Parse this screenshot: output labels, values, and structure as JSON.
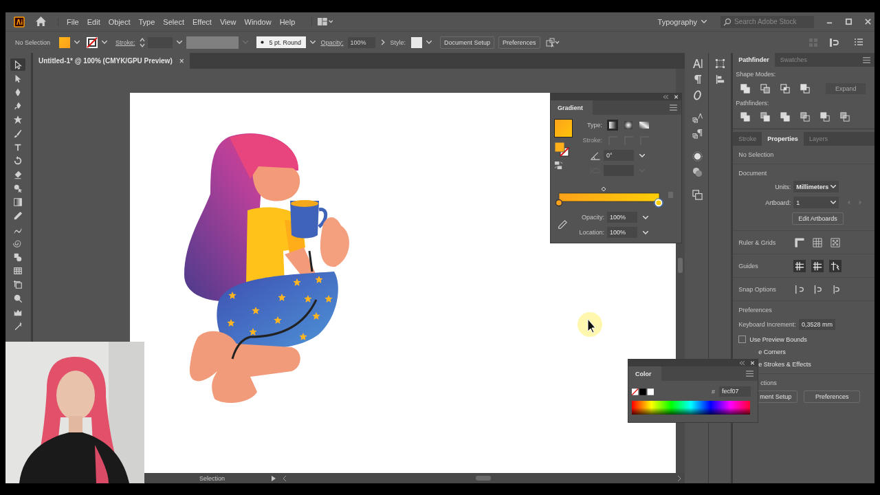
{
  "menu_bar": {
    "items": [
      "File",
      "Edit",
      "Object",
      "Type",
      "Select",
      "Effect",
      "View",
      "Window",
      "Help"
    ],
    "workspace": "Typography",
    "search": {
      "placeholder": "Search Adobe Stock"
    }
  },
  "control_bar": {
    "selection": "No Selection",
    "stroke_label": "Stroke:",
    "brush": "5 pt. Round",
    "opacity_label": "Opacity:",
    "opacity": "100%",
    "style_label": "Style:",
    "buttons": [
      "Document Setup",
      "Preferences"
    ]
  },
  "document_tab": {
    "title": "Untitled-1* @ 100% (CMYK/GPU Preview)",
    "close": "×"
  },
  "gradient_panel": {
    "title": "Gradient",
    "type_label": "Type:",
    "stroke_row": {
      "label": "Stroke:",
      "disabled": true
    },
    "angle": "0°",
    "stops": [
      {
        "selected": false
      },
      {
        "selected": true
      }
    ],
    "opacity_label": "Opacity:",
    "opacity": "100%",
    "location_label": "Location:",
    "location": "100%"
  },
  "right_panel": {
    "top_tabs": [
      {
        "label": "Pathfinder",
        "selected": true
      },
      {
        "label": "Swatches",
        "selected": false
      }
    ],
    "shape_modes": "Shape Modes:",
    "expand": {
      "label": "Expand",
      "disabled": true
    },
    "pathfinders": "Pathfinders:",
    "tabs": [
      {
        "label": "Stroke",
        "selected": false
      },
      {
        "label": "Properties",
        "selected": true
      },
      {
        "label": "Layers",
        "selected": false
      }
    ],
    "selection": "No Selection",
    "document": "Document",
    "units_label": "Units:",
    "units": "Millimeters",
    "artboard_label": "Artboard:",
    "artboard": "1",
    "edit_artboards": "Edit Artboards",
    "rows": [
      "Ruler & Grids",
      "Guides",
      "Snap Options"
    ],
    "preferences": "Preferences",
    "keyboard_label": "Keyboard Increment:",
    "keyboard": "0,3528 mm",
    "preview_bounds": {
      "label": "Use Preview Bounds",
      "checked": false
    },
    "covered_options": [
      "e Corners",
      "e Strokes & Effects"
    ],
    "quick_actions": "ctions",
    "buttons": [
      "ment Setup",
      "Preferences"
    ]
  },
  "color_panel": {
    "title": "Color",
    "hex_label": "#",
    "hex": "fecf07"
  },
  "status_bar": {
    "tool": "Selection"
  }
}
